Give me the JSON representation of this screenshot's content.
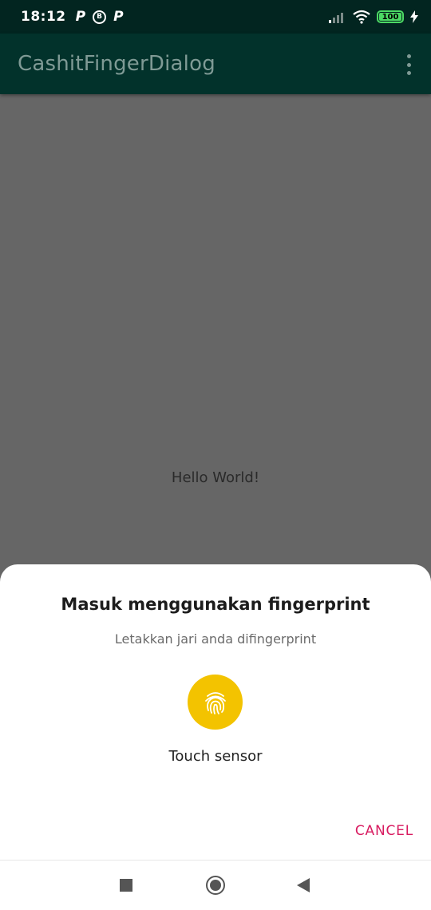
{
  "status_bar": {
    "time": "18:12",
    "left_icons": [
      "P",
      "B",
      "P"
    ],
    "battery_level": "100",
    "battery_color": "#4cd964"
  },
  "app_bar": {
    "title": "CashitFingerDialog",
    "background": "#02322b",
    "overflow_icon": "more-vert-icon"
  },
  "main": {
    "hello_text": "Hello World!"
  },
  "dialog": {
    "title": "Masuk menggunakan fingerprint",
    "subtitle": "Letakkan jari anda difingerprint",
    "icon": "fingerprint-icon",
    "icon_color": "#f3c300",
    "status": "Touch sensor",
    "cancel_label": "CANCEL",
    "cancel_color": "#d81b60"
  },
  "nav_bar": {
    "icons": [
      "recents-icon",
      "home-icon",
      "back-icon"
    ]
  }
}
